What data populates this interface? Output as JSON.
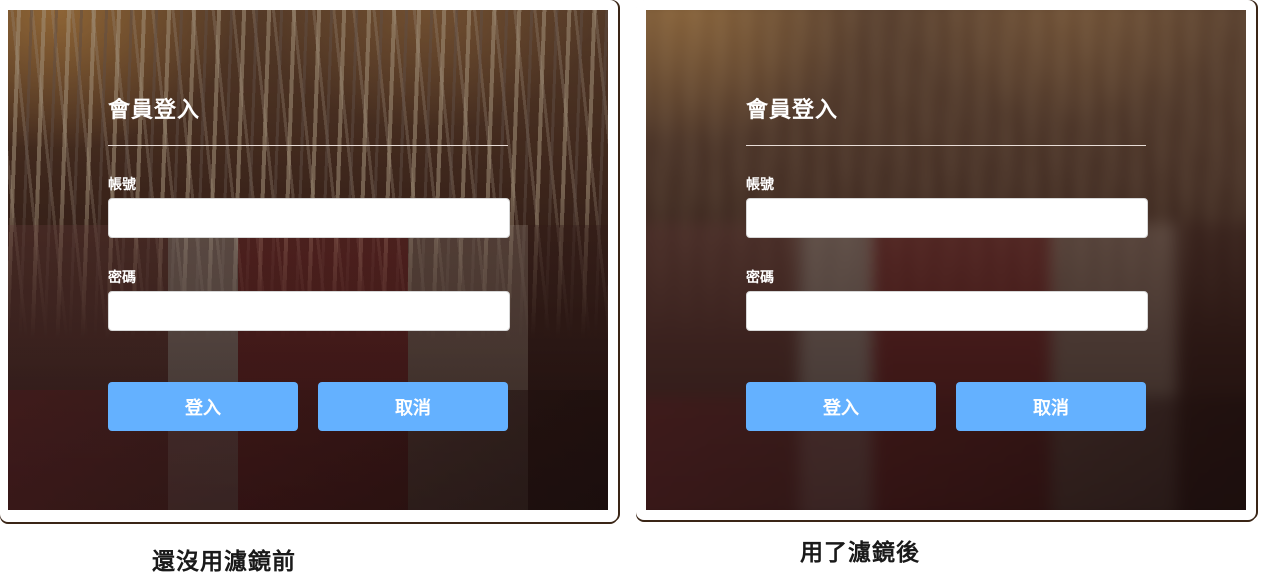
{
  "panels": {
    "before": {
      "form": {
        "title": "會員登入",
        "account_label": "帳號",
        "password_label": "密碼",
        "login_button": "登入",
        "cancel_button": "取消"
      },
      "caption": "還沒用濾鏡前"
    },
    "after": {
      "form": {
        "title": "會員登入",
        "account_label": "帳號",
        "password_label": "密碼",
        "login_button": "登入",
        "cancel_button": "取消"
      },
      "caption": "用了濾鏡後"
    }
  },
  "colors": {
    "button": "#64b1ff",
    "frame": "#ffffff",
    "text_light": "#ffffff",
    "caption": "#1a1a1a"
  }
}
